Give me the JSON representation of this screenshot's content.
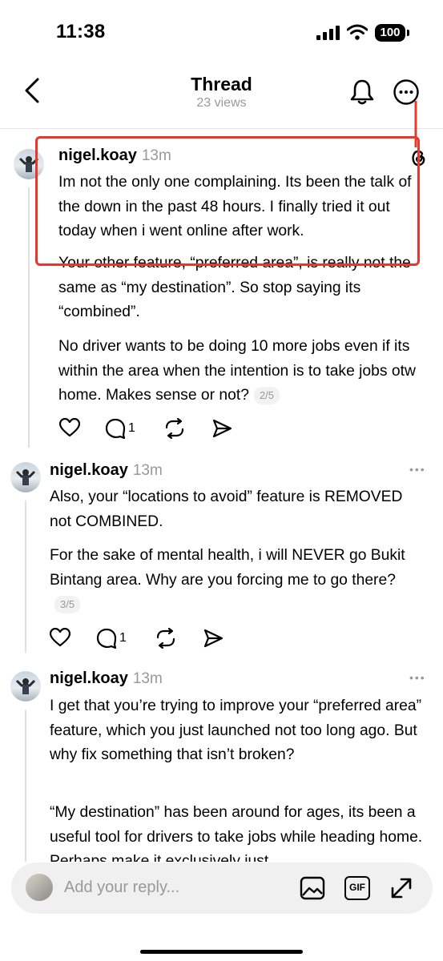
{
  "status_bar": {
    "time": "11:38",
    "battery": "100"
  },
  "header": {
    "title": "Thread",
    "views": "23 views"
  },
  "posts": [
    {
      "username": "nigel.koay",
      "time_ago": "13m",
      "paragraphs": [
        "Im not the only one complaining. Its been the talk of the down in the past 48 hours. I finally tried it out today when i went online after work.",
        "Your other feature, “preferred area”, is really not the same as “my destination”. So stop saying its “combined”.",
        "No driver wants to be doing 10 more jobs even if its within the area when the intention is to take jobs otw home. Makes sense or not?"
      ],
      "pager": "2/5",
      "reply_count": "1"
    },
    {
      "username": "nigel.koay",
      "time_ago": "13m",
      "paragraphs": [
        "Also, your “locations to avoid” feature is REMOVED not COMBINED.",
        "For the sake of mental health, i will NEVER go Bukit Bintang area. Why are you forcing me to go there?"
      ],
      "pager": "3/5",
      "reply_count": "1"
    },
    {
      "username": "nigel.koay",
      "time_ago": "13m",
      "paragraphs": [
        "I get that you’re trying to improve your “preferred area” feature, which you just launched not too long ago. But why fix something that isn’t broken?",
        "“My destination” has been around for ages, its been a useful tool for drivers to take jobs while heading home. Perhaps make it exclusively just"
      ]
    }
  ],
  "reply_bar": {
    "placeholder": "Add your reply...",
    "gif_label": "GIF"
  },
  "colors": {
    "annotation": "#e8382e",
    "muted": "#999999"
  },
  "icons": [
    "back-chevron-icon",
    "bell-icon",
    "more-icon",
    "threads-logo-icon",
    "heart-icon",
    "comment-icon",
    "repost-icon",
    "share-icon",
    "image-icon",
    "gif-icon",
    "expand-icon"
  ]
}
